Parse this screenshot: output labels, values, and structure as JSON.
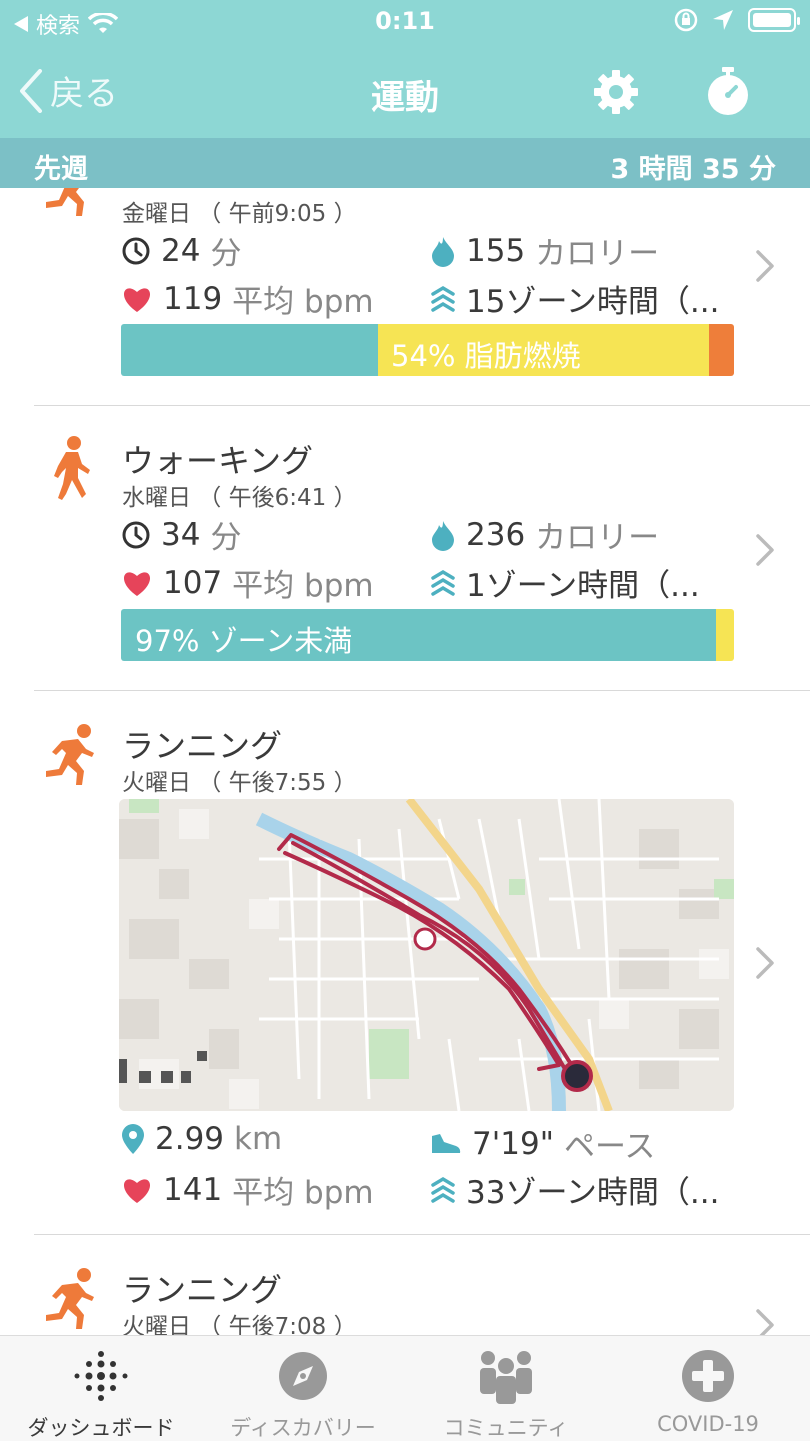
{
  "status_bar": {
    "carrier": "検索",
    "time": "0:11"
  },
  "nav": {
    "back_label": "戻る",
    "title": "運動"
  },
  "week": {
    "label": "先週",
    "total": "3 時間 35 分"
  },
  "activities": [
    {
      "date": "金曜日 （ 午前9:05 ）",
      "duration": "24",
      "duration_unit": "分",
      "calories": "155",
      "calories_unit": "カロリー",
      "heart_rate": "119",
      "heart_unit": "平均 bpm",
      "zone_minutes": "15ゾーン時間（...",
      "bar_label": "54% 脂肪燃焼",
      "bar": {
        "teal": 0.42,
        "yellow": 0.54,
        "orange": 0.04
      }
    },
    {
      "name": "ウォーキング",
      "date": "水曜日 （ 午後6:41 ）",
      "duration": "34",
      "duration_unit": "分",
      "calories": "236",
      "calories_unit": "カロリー",
      "heart_rate": "107",
      "heart_unit": "平均 bpm",
      "zone_minutes": "1ゾーン時間（...",
      "bar_label": "97% ゾーン未満",
      "bar": {
        "teal": 0.97,
        "yellow": 0.03,
        "orange": 0.0
      }
    },
    {
      "name": "ランニング",
      "date": "火曜日 （ 午後7:55 ）",
      "distance": "2.99",
      "distance_unit": "km",
      "pace": "7'19\"",
      "pace_unit": "ペース",
      "heart_rate": "141",
      "heart_unit": "平均 bpm",
      "zone_minutes": "33ゾーン時間（..."
    },
    {
      "name": "ランニング",
      "date": "火曜日 （ 午後7:08 ）"
    }
  ],
  "tabs": [
    {
      "label": "ダッシュボード",
      "icon": "dots-icon",
      "active": true
    },
    {
      "label": "ディスカバリー",
      "icon": "compass-icon",
      "active": false
    },
    {
      "label": "コミュニティ",
      "icon": "community-icon",
      "active": false
    },
    {
      "label": "COVID-19",
      "icon": "plus-icon",
      "active": false
    }
  ],
  "colors": {
    "header": "#8dd7d4",
    "week_bar": "#7cc0c6",
    "teal_zone": "#6cc4c4",
    "yellow_zone": "#f6e454",
    "orange_zone": "#ee7e3a",
    "activity_orange": "#ee7a3a",
    "heart": "#e6445a",
    "route": "#b22a4a"
  }
}
